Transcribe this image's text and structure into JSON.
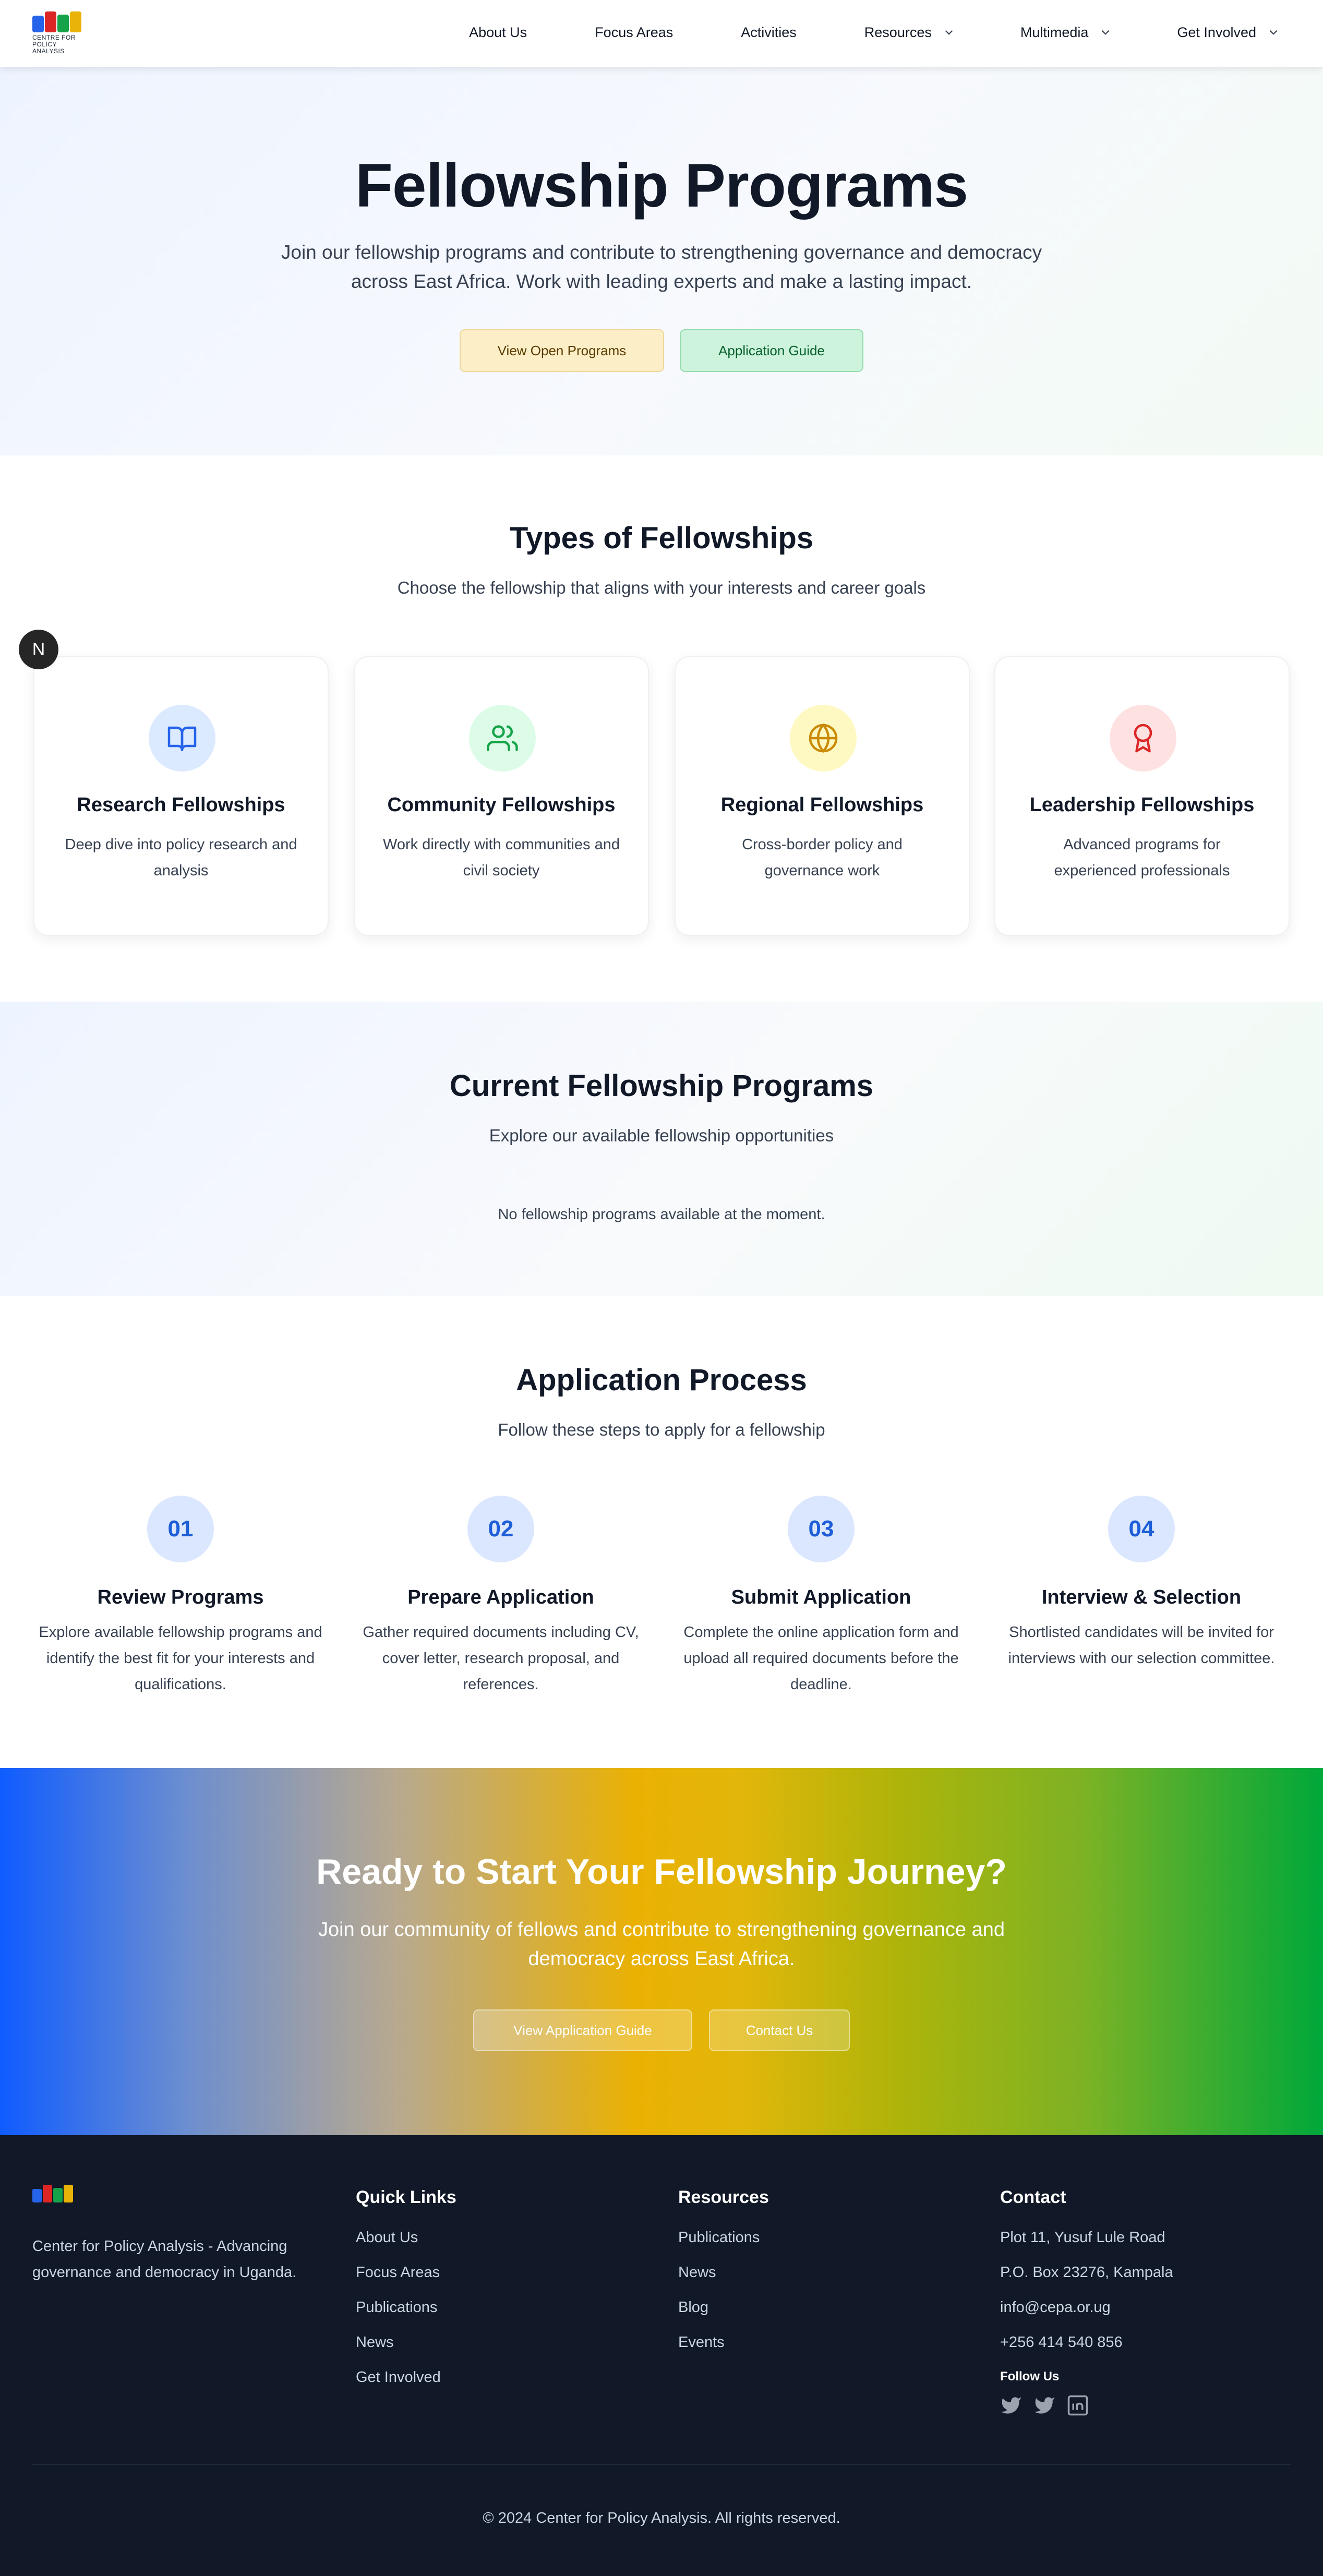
{
  "nav": {
    "logo_text": "CENTRE FOR POLICY ANALYSIS",
    "items": [
      {
        "label": "About Us"
      },
      {
        "label": "Focus Areas"
      },
      {
        "label": "Activities"
      },
      {
        "label": "Resources"
      },
      {
        "label": "Multimedia"
      },
      {
        "label": "Get Involved"
      }
    ]
  },
  "hero": {
    "title": "Fellowship Programs",
    "subtitle": "Join our fellowship programs and contribute to strengthening governance and democracy across East Africa. Work with leading experts and make a lasting impact.",
    "primary_button": "View Open Programs",
    "secondary_button": "Application Guide"
  },
  "badge": {
    "letter": "N"
  },
  "types": {
    "title": "Types of Fellowships",
    "subtitle": "Choose the fellowship that aligns with your interests and career goals",
    "cards": [
      {
        "title": "Research Fellowships",
        "description": "Deep dive into policy research and analysis",
        "icon": "book-open-icon",
        "color": "#2563eb",
        "bg": "#dbeafe"
      },
      {
        "title": "Community Fellowships",
        "description": "Work directly with communities and civil society",
        "icon": "users-icon",
        "color": "#16a34a",
        "bg": "#dcfce7"
      },
      {
        "title": "Regional Fellowships",
        "description": "Cross-border policy and governance work",
        "icon": "globe-icon",
        "color": "#ca8a04",
        "bg": "#fef9c3"
      },
      {
        "title": "Leadership Fellowships",
        "description": "Advanced programs for experienced professionals",
        "icon": "award-icon",
        "color": "#dc2626",
        "bg": "#fee2e2"
      }
    ]
  },
  "current": {
    "title": "Current Fellowship Programs",
    "subtitle": "Explore our available fellowship opportunities",
    "empty_message": "No fellowship programs available at the moment."
  },
  "process": {
    "title": "Application Process",
    "subtitle": "Follow these steps to apply for a fellowship",
    "steps": [
      {
        "number": "01",
        "title": "Review Programs",
        "description": "Explore available fellowship programs and identify the best fit for your interests and qualifications."
      },
      {
        "number": "02",
        "title": "Prepare Application",
        "description": "Gather required documents including CV, cover letter, research proposal, and references."
      },
      {
        "number": "03",
        "title": "Submit Application",
        "description": "Complete the online application form and upload all required documents before the deadline."
      },
      {
        "number": "04",
        "title": "Interview & Selection",
        "description": "Shortlisted candidates will be invited for interviews with our selection committee."
      }
    ]
  },
  "cta": {
    "title": "Ready to Start Your Fellowship Journey?",
    "subtitle": "Join our community of fellows and contribute to strengthening governance and democracy across East Africa.",
    "guide_button": "View Application Guide",
    "contact_button": "Contact Us"
  },
  "footer": {
    "about": "Center for Policy Analysis - Advancing governance and democracy in Uganda.",
    "quick_links": {
      "title": "Quick Links",
      "items": [
        "About Us",
        "Focus Areas",
        "Publications",
        "News",
        "Get Involved"
      ]
    },
    "resources": {
      "title": "Resources",
      "items": [
        "Publications",
        "News",
        "Blog",
        "Events"
      ]
    },
    "contact": {
      "title": "Contact",
      "items": [
        "Plot 11, Yusuf Lule Road",
        "P.O. Box 23276, Kampala",
        "info@cepa.or.ug",
        "+256 414 540 856"
      ],
      "follow_label": "Follow Us"
    },
    "social": [
      "twitter-icon",
      "twitter-icon",
      "linkedin-icon"
    ],
    "copyright": "© 2024 Center for Policy Analysis. All rights reserved."
  },
  "colors": {
    "blue": "#2563eb",
    "green": "#16a34a",
    "yellow": "#ca8a04",
    "red": "#dc2626",
    "footer_bg": "#111827"
  }
}
